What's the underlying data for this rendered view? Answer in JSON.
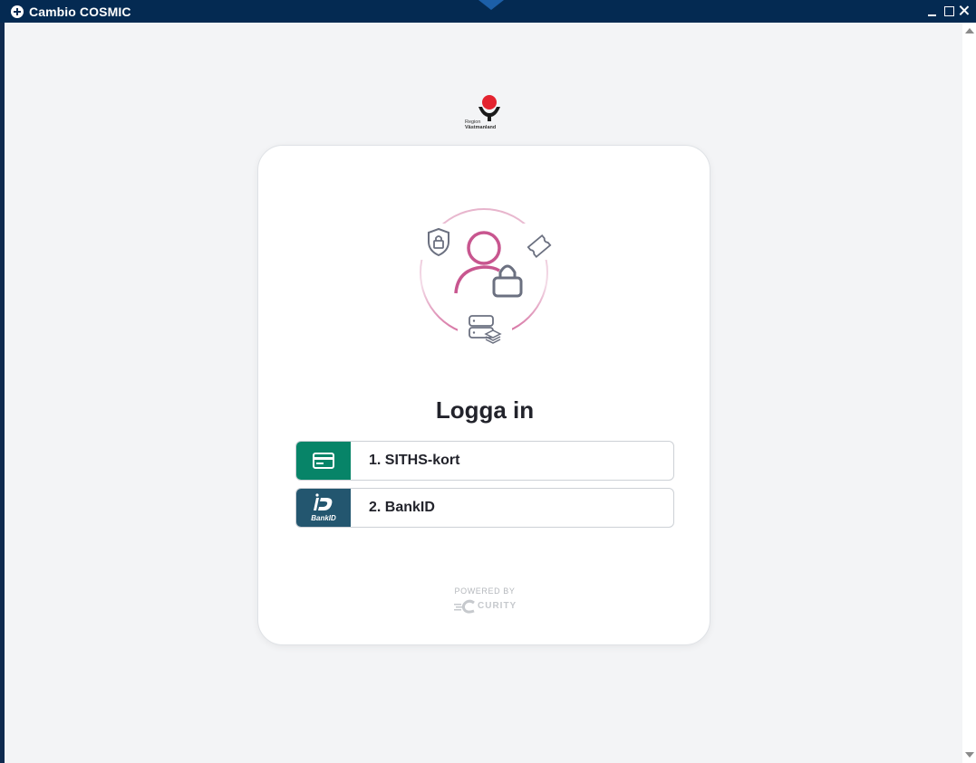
{
  "window": {
    "title": "Cambio COSMIC"
  },
  "logo": {
    "line1": "Region",
    "line2": "Västmanland"
  },
  "login": {
    "heading": "Logga in",
    "options": [
      {
        "label": "1. SITHS-kort",
        "icon": "card-icon"
      },
      {
        "label": "2. BankID",
        "icon": "bankid-icon",
        "icon_text": "BankID"
      }
    ]
  },
  "footer": {
    "powered_by": "POWERED BY",
    "brand": "CURITY"
  },
  "colors": {
    "titlebar": "#042a52",
    "siths": "#078468",
    "bankid": "#23566f",
    "accent_pink": "#c8568f",
    "logo_red": "#e4232f"
  }
}
